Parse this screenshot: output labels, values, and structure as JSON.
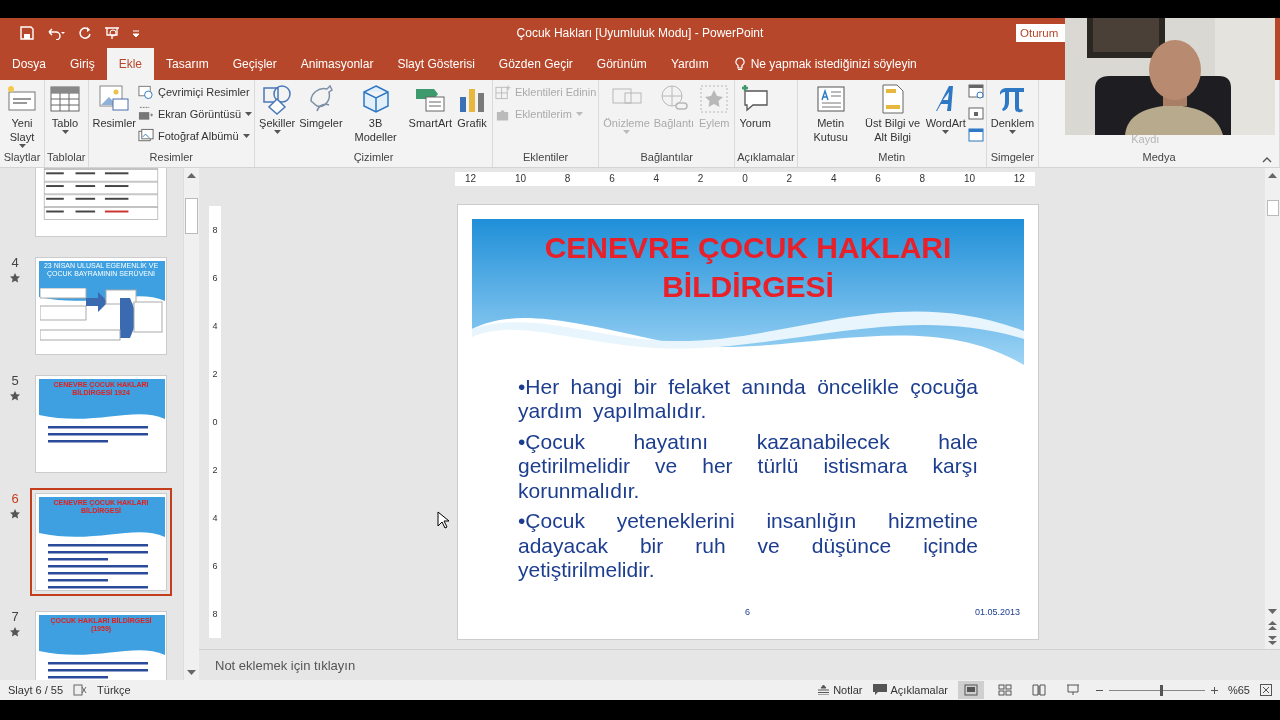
{
  "window": {
    "title": "Çocuk Hakları [Uyumluluk Modu]  -  PowerPoint",
    "signin": "Oturum"
  },
  "tabs": [
    {
      "label": "Dosya",
      "selected": false
    },
    {
      "label": "Giriş",
      "selected": false
    },
    {
      "label": "Ekle",
      "selected": true
    },
    {
      "label": "Tasarım",
      "selected": false
    },
    {
      "label": "Geçişler",
      "selected": false
    },
    {
      "label": "Animasyonlar",
      "selected": false
    },
    {
      "label": "Slayt Gösterisi",
      "selected": false
    },
    {
      "label": "Gözden Geçir",
      "selected": false
    },
    {
      "label": "Görünüm",
      "selected": false
    },
    {
      "label": "Yardım",
      "selected": false
    }
  ],
  "tell_me": "Ne yapmak istediğinizi söyleyin",
  "ribbon": {
    "groups": [
      {
        "label": "Slaytlar",
        "commands": [
          {
            "kind": "big",
            "label": "Yeni Slayt",
            "caret": true,
            "disabled": false
          }
        ]
      },
      {
        "label": "Tablolar",
        "commands": [
          {
            "kind": "big",
            "label": "Tablo",
            "caret": true,
            "disabled": false
          }
        ]
      },
      {
        "label": "Resimler",
        "commands": [
          {
            "kind": "big",
            "label": "Resimler",
            "caret": false,
            "disabled": false
          },
          {
            "kind": "small",
            "label": "Çevrimiçi Resimler",
            "caret": false,
            "disabled": false
          },
          {
            "kind": "small",
            "label": "Ekran Görüntüsü",
            "caret": true,
            "disabled": false
          },
          {
            "kind": "small",
            "label": "Fotoğraf Albümü",
            "caret": true,
            "disabled": false
          }
        ]
      },
      {
        "label": "Çizimler",
        "commands": [
          {
            "kind": "big",
            "label": "Şekiller",
            "caret": true,
            "disabled": false
          },
          {
            "kind": "big",
            "label": "Simgeler",
            "caret": false,
            "disabled": false
          },
          {
            "kind": "big",
            "label": "3B Modeller",
            "caret": false,
            "disabled": false
          },
          {
            "kind": "big",
            "label": "SmartArt",
            "caret": false,
            "disabled": false
          },
          {
            "kind": "big",
            "label": "Grafik",
            "caret": false,
            "disabled": false
          }
        ]
      },
      {
        "label": "Eklentiler",
        "commands": [
          {
            "kind": "small",
            "label": "Eklentileri Edinin",
            "caret": false,
            "disabled": true
          },
          {
            "kind": "small",
            "label": "Eklentilerim",
            "caret": true,
            "disabled": true
          }
        ]
      },
      {
        "label": "Bağlantılar",
        "commands": [
          {
            "kind": "big",
            "label": "Önizleme",
            "caret": true,
            "disabled": true
          },
          {
            "kind": "big",
            "label": "Bağlantı",
            "caret": false,
            "disabled": true
          },
          {
            "kind": "big",
            "label": "Eylem",
            "caret": false,
            "disabled": true
          }
        ]
      },
      {
        "label": "Açıklamalar",
        "commands": [
          {
            "kind": "big",
            "label": "Yorum",
            "caret": false,
            "disabled": false
          }
        ]
      },
      {
        "label": "Metin",
        "commands": [
          {
            "kind": "big",
            "label": "Metin Kutusu",
            "caret": false,
            "disabled": false
          },
          {
            "kind": "big",
            "label": "Üst Bilgi ve Alt Bilgi",
            "caret": false,
            "disabled": false
          },
          {
            "kind": "big",
            "label": "WordArt",
            "caret": true,
            "disabled": false
          },
          {
            "kind": "icons"
          }
        ]
      },
      {
        "label": "Simgeler",
        "commands": [
          {
            "kind": "big",
            "label": "Denklem",
            "caret": true,
            "disabled": false
          }
        ]
      },
      {
        "label": "Medya",
        "commands": [
          {
            "kind": "faint",
            "label": "Kaydı"
          }
        ]
      }
    ]
  },
  "thumbnails": [
    {
      "kind": "table",
      "selected": false
    },
    {
      "kind": "diagram",
      "number": "4",
      "title": "23 NİSAN ULUSAL EGEMENLİK VE ÇOCUK BAYRAMININ SERÜVENİ",
      "selected": false
    },
    {
      "kind": "text",
      "number": "5",
      "title": "CENEVRE ÇOCUK HAKLARI BİLDİRGESİ 1924",
      "selected": false
    },
    {
      "kind": "text",
      "number": "6",
      "title": "CENEVRE ÇOCUK HAKLARI BİLDİRGESİ",
      "selected": true
    },
    {
      "kind": "text",
      "number": "7",
      "title": "ÇOCUK HAKLARI BİLDİRGESİ (1959)",
      "selected": false
    }
  ],
  "ruler": {
    "horizontal": [
      "12",
      "10",
      "8",
      "6",
      "4",
      "2",
      "0",
      "2",
      "4",
      "6",
      "8",
      "10",
      "12"
    ],
    "vertical": [
      "8",
      "6",
      "4",
      "2",
      "0",
      "2",
      "4",
      "6",
      "8"
    ]
  },
  "slide": {
    "title": "CENEVRE ÇOCUK HAKLARI BİLDİRGESİ",
    "bullets": [
      "•Her hangi bir felaket anında öncelikle çocuğa yardım yapılmalıdır.",
      "•Çocuk hayatını kazanabilecek hale getirilmelidir ve her türlü istismara karşı korunmalıdır.",
      "•Çocuk yeteneklerini insanlığın hizmetine adayacak bir ruh ve düşünce içinde yetiştirilmelidir."
    ],
    "number": "6",
    "date": "01.05.2013"
  },
  "notes_placeholder": "Not eklemek için tıklayın",
  "status_bar": {
    "slide": "Slayt 6 / 55",
    "language": "Türkçe",
    "notes": "Notlar",
    "comments": "Açıklamalar",
    "zoom": "%65",
    "zoom_slider": {
      "level": 0.55
    },
    "views": [
      {
        "selected": true
      },
      {
        "selected": false
      },
      {
        "selected": false
      },
      {
        "selected": false
      }
    ]
  }
}
